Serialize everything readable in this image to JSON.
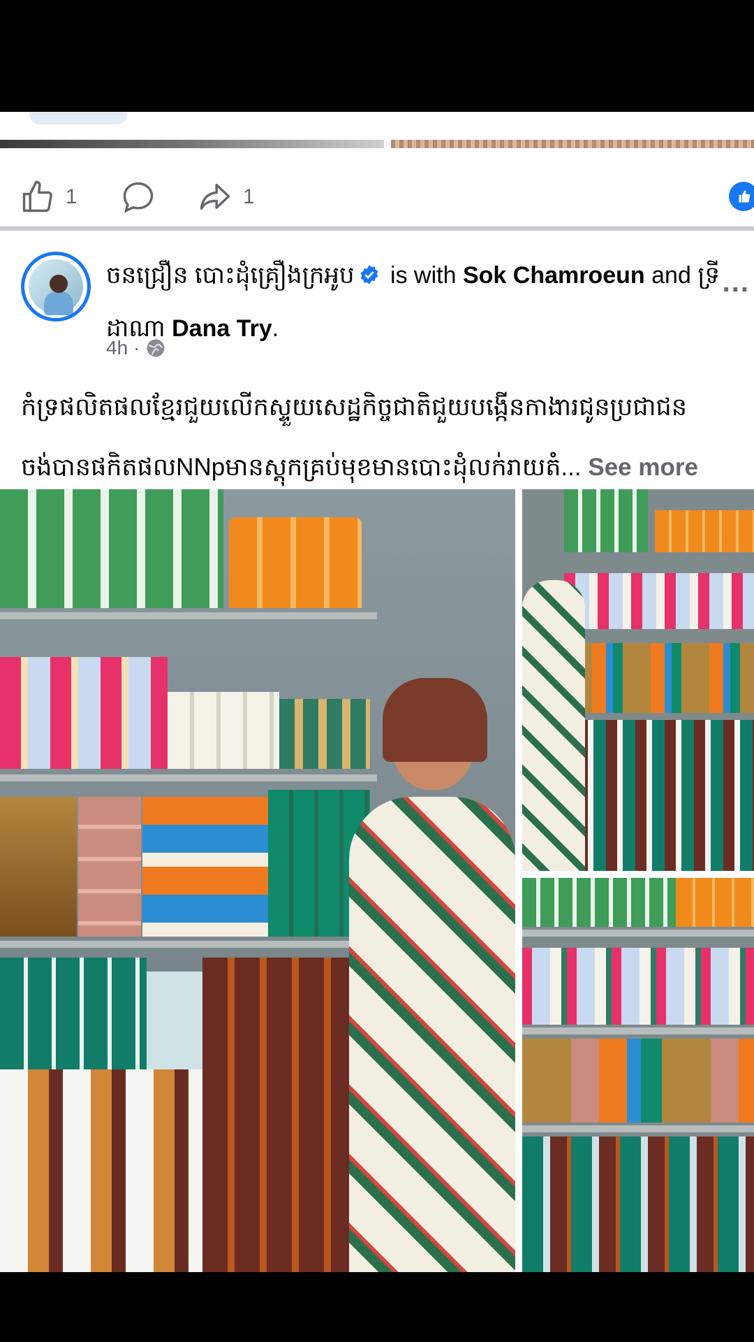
{
  "reactions_prev": {
    "like_count": "1",
    "share_count": "1"
  },
  "post": {
    "author": "ចនជ្រឿន បោះដំុគ្រឿងក្រអូប",
    "with_text": "is with",
    "tag1": "Sok Chamroeun",
    "and_text": "and",
    "tag2_khmer": "ទ្រី ដាណា",
    "tag2": "Dana Try",
    "end_punct": ".",
    "time": "4h",
    "dot": "·",
    "caption_line1": "កំទ្រផលិតផលខ្មែរជួយលើកស្ទួយសេដ្ឋកិច្ចជាតិជួយបង្កើនកាងារជូនប្រជាជន",
    "caption_line2": "ចង់បានផកិតផលNNpមានស្តុកគ្រប់មុខមានបោះដុំលក់រាយតំ...",
    "see_more": "See more",
    "more_menu": "..."
  },
  "icons": {
    "like": "thumbs-up-icon",
    "comment": "comment-bubble-icon",
    "share": "share-arrow-icon",
    "verified": "verified-badge-icon",
    "globe": "globe-icon",
    "reaction_like": "like-reaction-icon"
  },
  "colors": {
    "brand": "#1877f2",
    "secondary_text": "#65676b"
  }
}
